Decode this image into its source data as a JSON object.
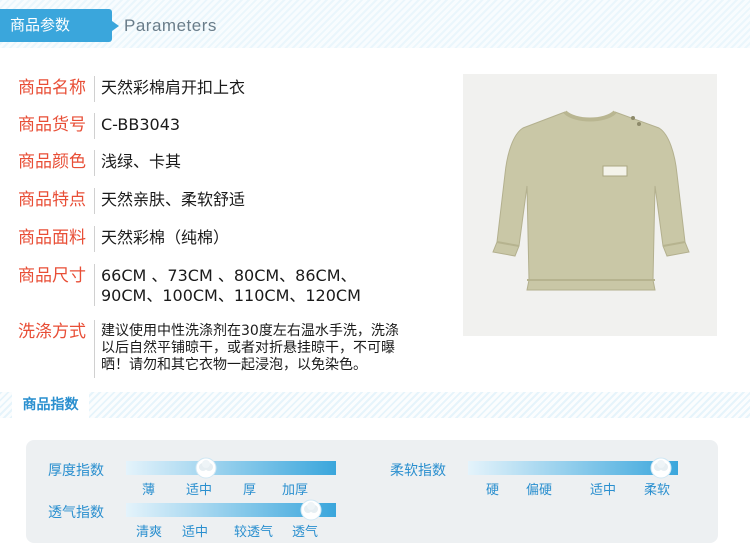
{
  "header": {
    "title": "商品参数",
    "subtitle": "Parameters"
  },
  "params": [
    {
      "label": "商品名称",
      "value": [
        "天然彩棉肩开扣上衣"
      ]
    },
    {
      "label": "商品货号",
      "value": [
        "C-BB3043"
      ]
    },
    {
      "label": "商品颜色",
      "value": [
        "浅绿、卡其"
      ]
    },
    {
      "label": "商品特点",
      "value": [
        "天然亲肤、柔软舒适"
      ]
    },
    {
      "label": "商品面料",
      "value": [
        " 天然彩棉（纯棉）"
      ]
    },
    {
      "label": "商品尺寸",
      "value": [
        "66CM 、73CM 、80CM、86CM、",
        "90CM、100CM、110CM、120CM"
      ]
    },
    {
      "label": "洗涤方式",
      "value": [
        "建议使用中性洗涤剂在30度左右温水手洗，洗涤",
        "以后自然平铺晾干，或者对折悬挂晾干，不可曝",
        "晒！请勿和其它衣物一起浸泡，以免染色。"
      ]
    }
  ],
  "product_image": {
    "icon": "long-sleeve-shirt-icon",
    "color": "#c9c7a6"
  },
  "indices": {
    "title": "商品指数",
    "accent": "#3aa6dc",
    "thickness": {
      "label": "厚度指数",
      "ticks": [
        "薄",
        "适中",
        "厚",
        "加厚"
      ],
      "level": 0.38
    },
    "softness": {
      "label": "柔软指数",
      "ticks": [
        "硬",
        "偏硬",
        "适中",
        "柔软"
      ],
      "level": 0.92
    },
    "breathability": {
      "label": "透气指数",
      "ticks": [
        "清爽",
        "适中",
        "较透气",
        "透气"
      ],
      "level": 0.88
    }
  }
}
